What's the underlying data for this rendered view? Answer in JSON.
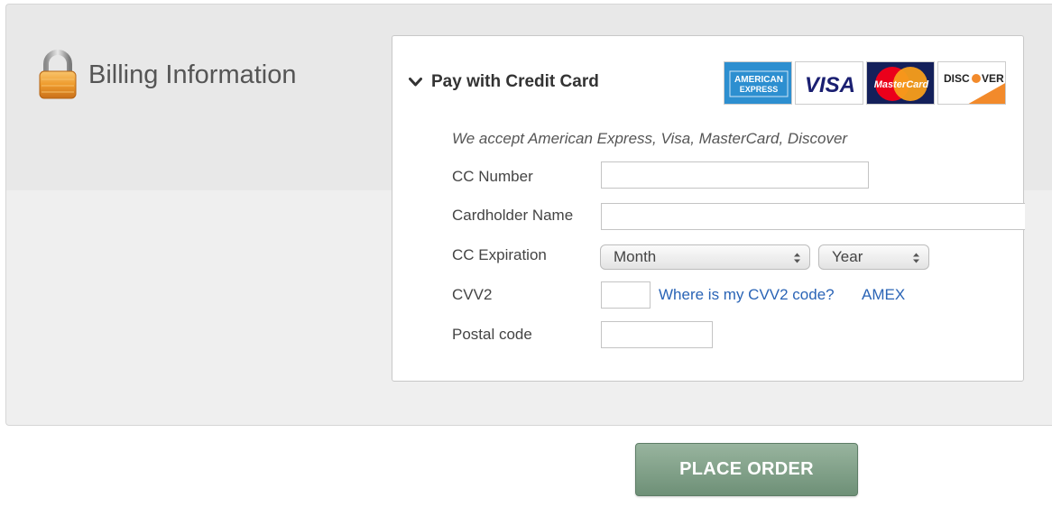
{
  "billing": {
    "title": "Billing Information",
    "lock_icon": "lock-icon"
  },
  "payment": {
    "title": "Pay with Credit Card",
    "collapse_icon": "chevron-down-icon",
    "card_logos": [
      {
        "name": "amex-logo",
        "line1": "AMERICAN",
        "line2": "EXPRESS",
        "color": "#2d8fd0"
      },
      {
        "name": "visa-logo",
        "text": "VISA",
        "color": "#1a1f71"
      },
      {
        "name": "mastercard-logo",
        "text": "MasterCard",
        "color": "#ff9900"
      },
      {
        "name": "discover-logo",
        "text_pre": "DISC",
        "text_post": "VER",
        "color": "#f28a2b"
      }
    ],
    "accept_note": "We accept American Express, Visa, MasterCard, Discover",
    "fields": {
      "cc_number": {
        "label": "CC Number",
        "value": ""
      },
      "cardholder_name": {
        "label": "Cardholder Name",
        "value": ""
      },
      "expiration": {
        "label": "CC Expiration",
        "month_value": "Month",
        "year_value": "Year"
      },
      "cvv2": {
        "label": "CVV2",
        "value": "",
        "help_link": "Where is my CVV2 code?",
        "amex_link": "AMEX"
      },
      "postal_code": {
        "label": "Postal code",
        "value": ""
      }
    }
  },
  "actions": {
    "place_order": "PLACE ORDER"
  },
  "colors": {
    "link": "#2a64b6",
    "button": "#7c9c84"
  }
}
